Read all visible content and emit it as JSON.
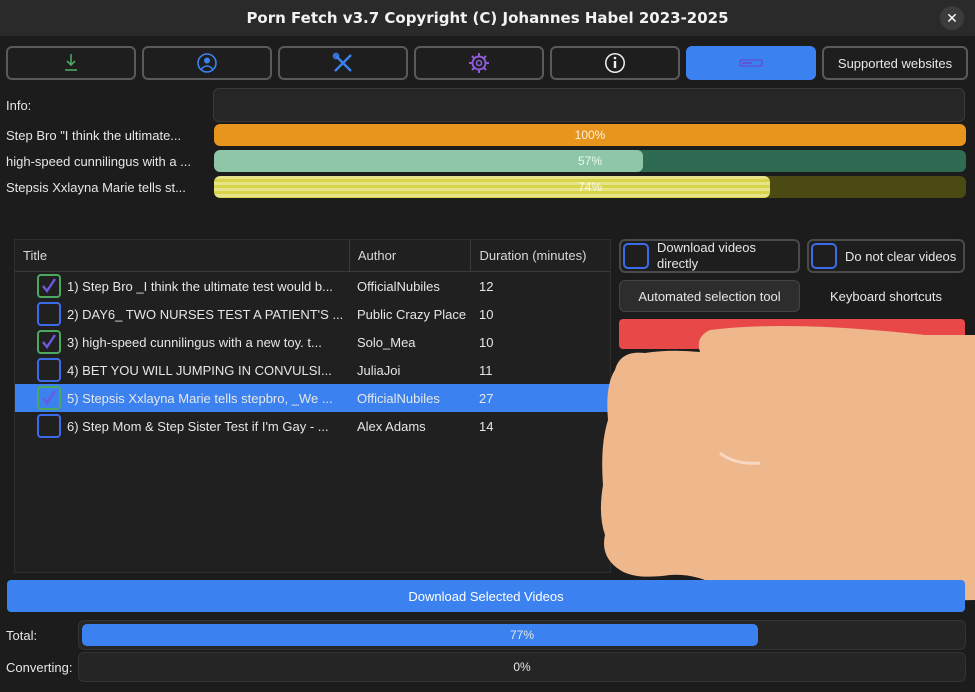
{
  "window": {
    "title": "Porn Fetch v3.7 Copyright (C) Johannes Habel 2023-2025"
  },
  "tabs": [
    {
      "icon": "download-icon",
      "active": false
    },
    {
      "icon": "user-icon",
      "active": false
    },
    {
      "icon": "tools-icon",
      "active": false
    },
    {
      "icon": "gear-icon",
      "active": false
    },
    {
      "icon": "info-icon",
      "active": false
    },
    {
      "icon": "progress-icon",
      "active": true
    },
    {
      "label": "Supported websites"
    }
  ],
  "status": {
    "info_label": "Info:",
    "downloads": [
      {
        "label": "Step Bro \"I think the ultimate...",
        "percent_text": "100%",
        "progress": 1.0,
        "color": "#e8951e"
      },
      {
        "label": "high-speed cunnilingus with a ...",
        "percent_text": "57%",
        "progress": 0.57,
        "color": "#8fc6a8"
      },
      {
        "label": "Stepsis Xxlayna Marie tells st...",
        "percent_text": "74%",
        "progress": 0.74,
        "color": "#d8d44a"
      }
    ]
  },
  "table": {
    "columns": [
      "Title",
      "Author",
      "Duration (minutes)"
    ],
    "rows": [
      {
        "title": "1) Step Bro _I think the ultimate test would b...",
        "author": "OfficialNubiles",
        "duration": "12",
        "checked": true,
        "selected": false
      },
      {
        "title": "2) DAY6_ TWO NURSES TEST A PATIENT'S ...",
        "author": "Public Crazy Place",
        "duration": "10",
        "checked": false,
        "selected": false
      },
      {
        "title": "3) high-speed cunnilingus with a new toy. t...",
        "author": "Solo_Mea",
        "duration": "10",
        "checked": true,
        "selected": false
      },
      {
        "title": "4) BET YOU WILL JUMPING IN CONVULSI...",
        "author": "JuliaJoi",
        "duration": "11",
        "checked": false,
        "selected": false
      },
      {
        "title": "5) Stepsis Xxlayna Marie tells stepbro, _We ...",
        "author": "OfficialNubiles",
        "duration": "27",
        "checked": true,
        "selected": true
      },
      {
        "title": "6) Step Mom & Step Sister Test if I'm Gay - ...",
        "author": "Alex Adams",
        "duration": "14",
        "checked": false,
        "selected": false
      }
    ]
  },
  "options": {
    "download_directly": "Download videos directly",
    "do_not_clear": "Do not clear videos",
    "automated_selection": "Automated selection tool",
    "keyboard_shortcuts": "Keyboard shortcuts"
  },
  "download_selected": "Download Selected Videos",
  "totals": {
    "total_label": "Total:",
    "total_percent_text": "77%",
    "total_progress": 0.77,
    "converting_label": "Converting:",
    "converting_percent_text": "0%",
    "converting_progress": 0
  },
  "colors": {
    "accent": "#3b82f0",
    "danger": "#e84848"
  }
}
